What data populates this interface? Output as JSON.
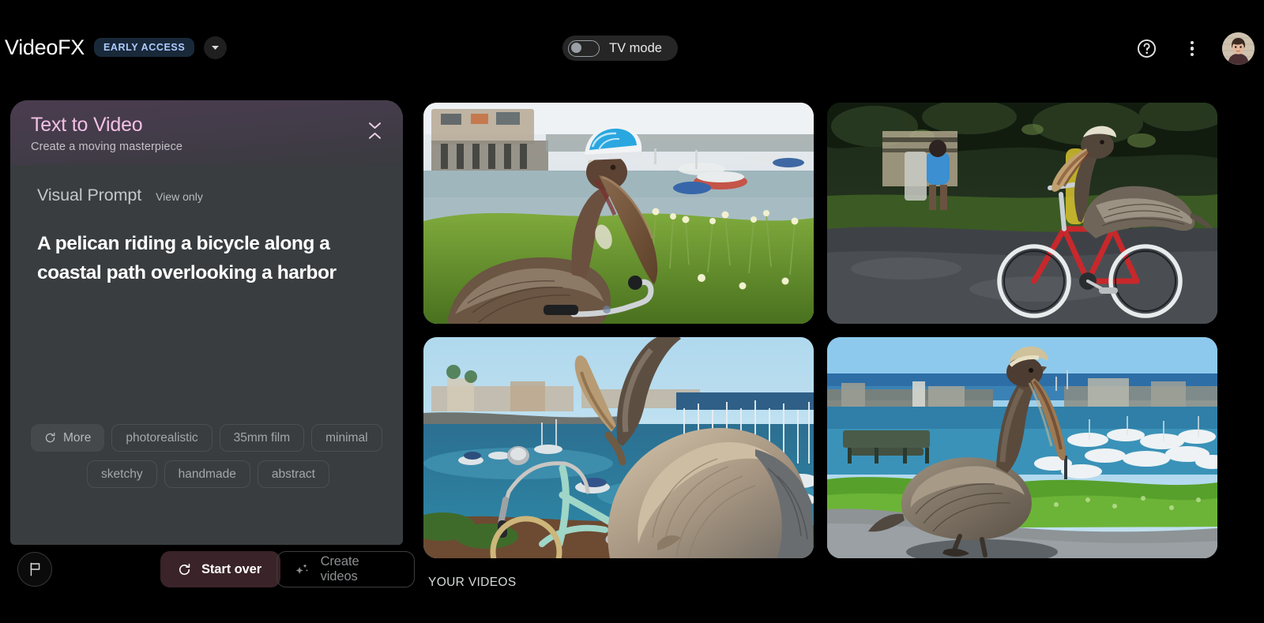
{
  "app": {
    "brand": "VideoFX",
    "badge": "EARLY ACCESS"
  },
  "topbar": {
    "tv_mode_label": "TV mode",
    "tv_mode_on": false,
    "help_icon": "help-circle-icon",
    "menu_icon": "more-vertical-icon",
    "avatar_icon": "user-avatar"
  },
  "panel": {
    "title": "Text to Video",
    "subtitle": "Create a moving masterpiece",
    "prompt_label": "Visual Prompt",
    "prompt_access": "View only",
    "prompt_text": "A pelican riding a bicycle along a coastal path overlooking a harbor",
    "chips_row1": [
      {
        "label": "More",
        "icon": "refresh-icon",
        "filled": true
      },
      {
        "label": "photorealistic",
        "filled": false
      },
      {
        "label": "35mm film",
        "filled": false
      },
      {
        "label": "minimal",
        "filled": false
      }
    ],
    "chips_row2": [
      {
        "label": "sketchy",
        "filled": false
      },
      {
        "label": "handmade",
        "filled": false
      },
      {
        "label": "abstract",
        "filled": false
      }
    ]
  },
  "actions": {
    "flag_icon": "flag-icon",
    "start_over": "Start over",
    "start_over_icon": "refresh-icon",
    "create_videos": "Create videos",
    "create_videos_icon": "sparkle-icon"
  },
  "gallery": {
    "section_label": "YOUR VIDEOS",
    "videos": [
      {
        "alt": "Pelican wearing a blue and white cycling helmet standing in grass by a harbor"
      },
      {
        "alt": "Pelican riding a red bicycle along a shaded path"
      },
      {
        "alt": "Pelican perched on a mint bicycle overlooking a marina"
      },
      {
        "alt": "Pelican walking on a coastal path with a marina behind"
      }
    ]
  },
  "colors": {
    "accent_pink": "#f3c0e6",
    "badge_bg": "#19293a",
    "badge_text": "#aecbff",
    "panel_bg": "#393d40",
    "start_over_bg": "#3a2329"
  }
}
